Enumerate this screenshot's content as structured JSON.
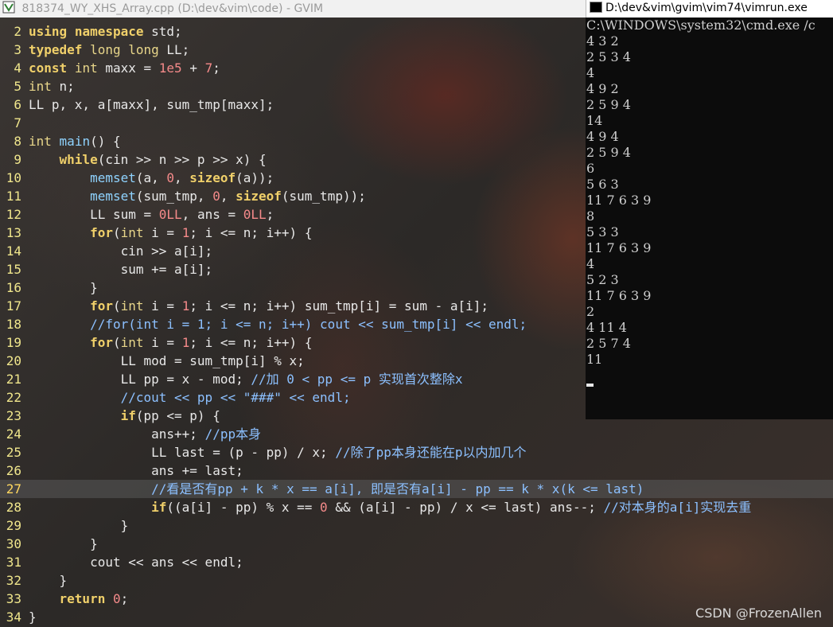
{
  "gvim": {
    "title": "818374_WY_XHS_Array.cpp (D:\\dev&vim\\code) - GVIM",
    "current_line": 27
  },
  "cmd": {
    "title": "D:\\dev&vim\\gvim\\vim74\\vimrun.exe",
    "lines": [
      "C:\\WINDOWS\\system32\\cmd.exe /c",
      "4 3 2",
      "2 5 3 4",
      "4",
      "4 9 2",
      "2 5 9 4",
      "14",
      "4 9 4",
      "2 5 9 4",
      "6",
      "5 6 3",
      "11 7 6 3 9",
      "8",
      "5 3 3",
      "11 7 6 3 9",
      "4",
      "5 2 3",
      "11 7 6 3 9",
      "2",
      "4 11 4",
      "2 5 7 4",
      "11"
    ]
  },
  "code": [
    {
      "n": "2",
      "t": [
        [
          "kw",
          "using"
        ],
        [
          "pl",
          " "
        ],
        [
          "kw",
          "namespace"
        ],
        [
          "pl",
          " std;"
        ]
      ]
    },
    {
      "n": "3",
      "t": [
        [
          "kw",
          "typedef"
        ],
        [
          "pl",
          " "
        ],
        [
          "ty",
          "long long"
        ],
        [
          "pl",
          " LL;"
        ]
      ]
    },
    {
      "n": "4",
      "t": [
        [
          "kw",
          "const"
        ],
        [
          "pl",
          " "
        ],
        [
          "ty",
          "int"
        ],
        [
          "pl",
          " maxx = "
        ],
        [
          "num",
          "1e5"
        ],
        [
          "pl",
          " + "
        ],
        [
          "num",
          "7"
        ],
        [
          "pl",
          ";"
        ]
      ]
    },
    {
      "n": "5",
      "t": [
        [
          "ty",
          "int"
        ],
        [
          "pl",
          " n;"
        ]
      ]
    },
    {
      "n": "6",
      "t": [
        [
          "pl",
          "LL p, x, a[maxx], sum_tmp[maxx];"
        ]
      ]
    },
    {
      "n": "7",
      "t": []
    },
    {
      "n": "8",
      "t": [
        [
          "ty",
          "int"
        ],
        [
          "pl",
          " "
        ],
        [
          "fn",
          "main"
        ],
        [
          "pl",
          "() {"
        ]
      ]
    },
    {
      "n": "9",
      "t": [
        [
          "pl",
          "    "
        ],
        [
          "kw",
          "while"
        ],
        [
          "pl",
          "(cin >> n >> p >> x) {"
        ]
      ]
    },
    {
      "n": "10",
      "t": [
        [
          "pl",
          "        "
        ],
        [
          "fn",
          "memset"
        ],
        [
          "pl",
          "(a, "
        ],
        [
          "num",
          "0"
        ],
        [
          "pl",
          ", "
        ],
        [
          "kw",
          "sizeof"
        ],
        [
          "pl",
          "(a));"
        ]
      ]
    },
    {
      "n": "11",
      "t": [
        [
          "pl",
          "        "
        ],
        [
          "fn",
          "memset"
        ],
        [
          "pl",
          "(sum_tmp, "
        ],
        [
          "num",
          "0"
        ],
        [
          "pl",
          ", "
        ],
        [
          "kw",
          "sizeof"
        ],
        [
          "pl",
          "(sum_tmp));"
        ]
      ]
    },
    {
      "n": "12",
      "t": [
        [
          "pl",
          "        LL sum = "
        ],
        [
          "num",
          "0LL"
        ],
        [
          "pl",
          ", ans = "
        ],
        [
          "num",
          "0LL"
        ],
        [
          "pl",
          ";"
        ]
      ]
    },
    {
      "n": "13",
      "t": [
        [
          "pl",
          "        "
        ],
        [
          "kw",
          "for"
        ],
        [
          "pl",
          "("
        ],
        [
          "ty",
          "int"
        ],
        [
          "pl",
          " i = "
        ],
        [
          "num",
          "1"
        ],
        [
          "pl",
          "; i <= n; i++) {"
        ]
      ]
    },
    {
      "n": "14",
      "t": [
        [
          "pl",
          "            cin >> a[i];"
        ]
      ]
    },
    {
      "n": "15",
      "t": [
        [
          "pl",
          "            sum += a[i];"
        ]
      ]
    },
    {
      "n": "16",
      "t": [
        [
          "pl",
          "        }"
        ]
      ]
    },
    {
      "n": "17",
      "t": [
        [
          "pl",
          "        "
        ],
        [
          "kw",
          "for"
        ],
        [
          "pl",
          "("
        ],
        [
          "ty",
          "int"
        ],
        [
          "pl",
          " i = "
        ],
        [
          "num",
          "1"
        ],
        [
          "pl",
          "; i <= n; i++) sum_tmp[i] = sum - a[i];"
        ]
      ]
    },
    {
      "n": "18",
      "t": [
        [
          "pl",
          "        "
        ],
        [
          "cm",
          "//for(int i = 1; i <= n; i++) cout << sum_tmp[i] << endl;"
        ]
      ]
    },
    {
      "n": "19",
      "t": [
        [
          "pl",
          "        "
        ],
        [
          "kw",
          "for"
        ],
        [
          "pl",
          "("
        ],
        [
          "ty",
          "int"
        ],
        [
          "pl",
          " i = "
        ],
        [
          "num",
          "1"
        ],
        [
          "pl",
          "; i <= n; i++) {"
        ]
      ]
    },
    {
      "n": "20",
      "t": [
        [
          "pl",
          "            LL mod = sum_tmp[i] % x;"
        ]
      ]
    },
    {
      "n": "21",
      "t": [
        [
          "pl",
          "            LL pp = x - mod; "
        ],
        [
          "cm",
          "//加 0 < pp <= p 实现首次整除x"
        ]
      ]
    },
    {
      "n": "22",
      "t": [
        [
          "pl",
          "            "
        ],
        [
          "cm",
          "//cout << pp << \"###\" << endl;"
        ]
      ]
    },
    {
      "n": "23",
      "t": [
        [
          "pl",
          "            "
        ],
        [
          "kw",
          "if"
        ],
        [
          "pl",
          "(pp <= p) {"
        ]
      ]
    },
    {
      "n": "24",
      "t": [
        [
          "pl",
          "                ans++; "
        ],
        [
          "cm",
          "//pp本身"
        ]
      ]
    },
    {
      "n": "25",
      "t": [
        [
          "pl",
          "                LL last = (p - pp) / x; "
        ],
        [
          "cm",
          "//除了pp本身还能在p以内加几个"
        ]
      ]
    },
    {
      "n": "26",
      "t": [
        [
          "pl",
          "                ans += last;"
        ]
      ]
    },
    {
      "n": "27",
      "t": [
        [
          "pl",
          "                "
        ],
        [
          "cm",
          "//看是否有pp + k * x == a[i], 即是否有a[i] - pp == k * x(k <= last)"
        ]
      ]
    },
    {
      "n": "28",
      "t": [
        [
          "pl",
          "                "
        ],
        [
          "kw",
          "if"
        ],
        [
          "pl",
          "((a[i] - pp) % x == "
        ],
        [
          "num",
          "0"
        ],
        [
          "pl",
          " && (a[i] - pp) / x <= last) ans--; "
        ],
        [
          "cm",
          "//对本身的a[i]实现去重"
        ]
      ]
    },
    {
      "n": "29",
      "t": [
        [
          "pl",
          "            }"
        ]
      ]
    },
    {
      "n": "30",
      "t": [
        [
          "pl",
          "        }"
        ]
      ]
    },
    {
      "n": "31",
      "t": [
        [
          "pl",
          "        cout << ans << endl;"
        ]
      ]
    },
    {
      "n": "32",
      "t": [
        [
          "pl",
          "    }"
        ]
      ]
    },
    {
      "n": "33",
      "t": [
        [
          "pl",
          "    "
        ],
        [
          "kw",
          "return"
        ],
        [
          "pl",
          " "
        ],
        [
          "num",
          "0"
        ],
        [
          "pl",
          ";"
        ]
      ]
    },
    {
      "n": "34",
      "t": [
        [
          "pl",
          "}"
        ]
      ]
    }
  ],
  "watermark": "CSDN @FrozenAllen"
}
